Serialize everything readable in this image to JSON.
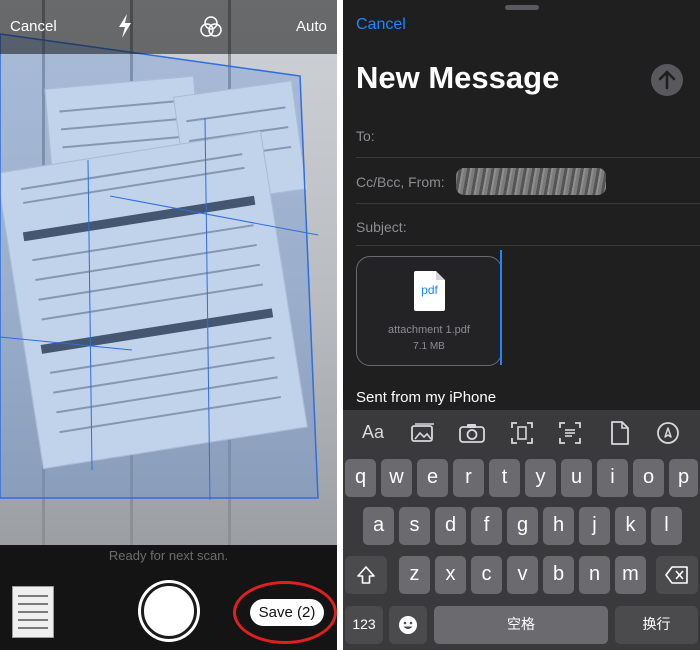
{
  "scanner": {
    "top_bar": {
      "cancel_label": "Cancel",
      "mode_label": "Auto"
    },
    "status_text": "Ready for next scan.",
    "save_label": "Save (2)"
  },
  "compose": {
    "cancel_label": "Cancel",
    "title": "New Message",
    "to_label": "To:",
    "cc_label": "Cc/Bcc, From:",
    "subject_label": "Subject:",
    "attachment": {
      "ext": "pdf",
      "name": "attachment 1.pdf",
      "size": "7.1 MB"
    },
    "signature": "Sent from my iPhone"
  },
  "keyboard": {
    "toolbar": {
      "format_label": "Aa"
    },
    "row1": [
      "q",
      "w",
      "e",
      "r",
      "t",
      "y",
      "u",
      "i",
      "o",
      "p"
    ],
    "row2": [
      "a",
      "s",
      "d",
      "f",
      "g",
      "h",
      "j",
      "k",
      "l"
    ],
    "row3": [
      "z",
      "x",
      "c",
      "v",
      "b",
      "n",
      "m"
    ],
    "numbers_label": "123",
    "space_label": "空格",
    "return_label": "换行"
  },
  "colors": {
    "accent": "#1e86ff",
    "highlight": "#e02020",
    "scan_overlay": "#5b8fe0"
  }
}
